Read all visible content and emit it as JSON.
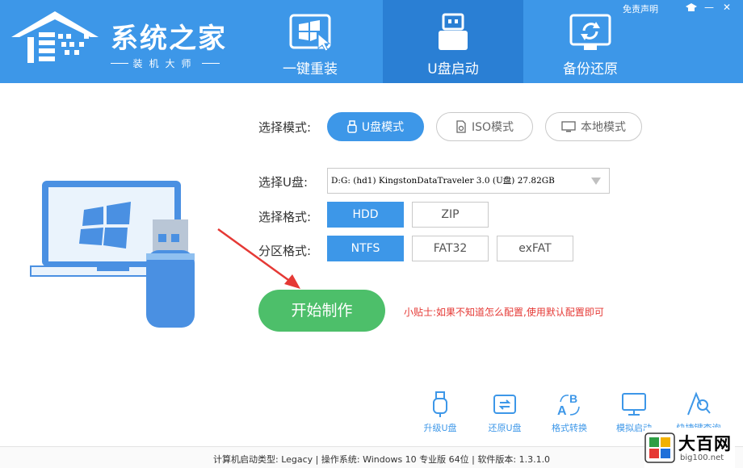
{
  "brand": {
    "title": "系统之家",
    "subtitle": "装机大师"
  },
  "top_links": "免责声明",
  "nav": [
    {
      "label": "一键重装",
      "icon": "windows-pointer-icon"
    },
    {
      "label": "U盘启动",
      "icon": "usb-drive-icon",
      "active": true
    },
    {
      "label": "备份还原",
      "icon": "backup-restore-icon"
    }
  ],
  "form": {
    "mode_label": "选择模式:",
    "modes": [
      "U盘模式",
      "ISO模式",
      "本地模式"
    ],
    "active_mode": "U盘模式",
    "udisk_label": "选择U盘:",
    "udisk_value": "D:G: (hd1) KingstonDataTraveler 3.0 (U盘) 27.82GB",
    "format_label": "选择格式:",
    "formats": [
      "HDD",
      "ZIP"
    ],
    "active_format": "HDD",
    "partition_label": "分区格式:",
    "partitions": [
      "NTFS",
      "FAT32",
      "exFAT"
    ],
    "active_partition": "NTFS",
    "start_label": "开始制作",
    "tip": "小贴士:如果不知道怎么配置,使用默认配置即可"
  },
  "tools": [
    {
      "label": "升级U盘",
      "icon": "usb-upgrade-icon"
    },
    {
      "label": "还原U盘",
      "icon": "usb-restore-icon"
    },
    {
      "label": "格式转换",
      "icon": "format-convert-icon"
    },
    {
      "label": "模拟启动",
      "icon": "monitor-icon"
    },
    {
      "label": "快捷键查询",
      "icon": "key-search-icon"
    }
  ],
  "footer": "计算机启动类型: Legacy | 操作系统: Windows 10 专业版 64位 | 软件版本: 1.3.1.0",
  "watermark": {
    "name": "大百网",
    "url": "big100.net"
  },
  "colors": {
    "primary": "#3d97e8",
    "tab_active": "#2a7fd4",
    "start": "#4dbf6a",
    "tip": "#e53935"
  }
}
